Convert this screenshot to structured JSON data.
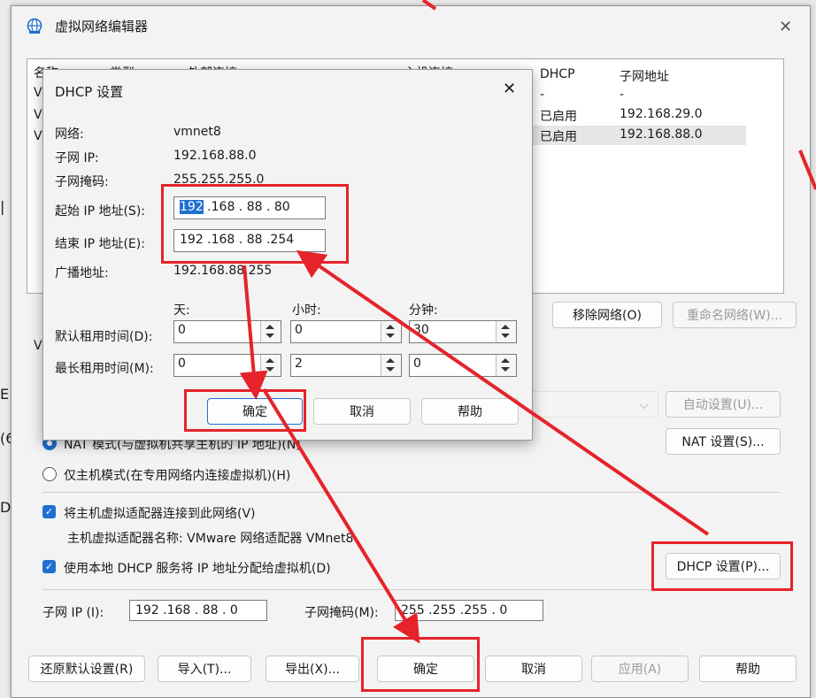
{
  "main": {
    "title": "虚拟网络编辑器",
    "close_label": "✕",
    "columns": [
      "名称",
      "类型",
      "外部连接",
      "主机连接",
      "DHCP",
      "子网地址"
    ],
    "left_clip": [
      "VI",
      "VI",
      "VI"
    ],
    "rows": [
      {
        "dhcp": "-",
        "subnet": "-"
      },
      {
        "dhcp": "已启用",
        "subnet": "192.168.29.0"
      },
      {
        "dhcp": "已启用",
        "subnet": "192.168.88.0"
      }
    ],
    "remove_network": "移除网络(O)",
    "rename_network": "重命名网络(W)...",
    "vm_clip": "V",
    "auto_settings": "自动设置(U)...",
    "nat_mode": "NAT 模式(与虚拟机共享主机的 IP 地址)(N)",
    "nat_settings": "NAT 设置(S)...",
    "host_only": "仅主机模式(在专用网络内连接虚拟机)(H)",
    "connect_adapter": "将主机虚拟适配器连接到此网络(V)",
    "adapter_name": "主机虚拟适配器名称: VMware 网络适配器 VMnet8",
    "use_dhcp": "使用本地 DHCP 服务将 IP 地址分配给虚拟机(D)",
    "dhcp_settings": "DHCP 设置(P)...",
    "subnet_ip_label": "子网 IP (I):",
    "subnet_ip": "192 .168 . 88 .  0",
    "subnet_mask_label": "子网掩码(M):",
    "subnet_mask": "255 .255 .255 .  0",
    "restore": "还原默认设置(R)",
    "import": "导入(T)...",
    "export": "导出(X)...",
    "ok": "确定",
    "cancel": "取消",
    "apply": "应用(A)",
    "help": "帮助"
  },
  "dhcp": {
    "title": "DHCP 设置",
    "close": "✕",
    "network_label": "网络:",
    "network": "vmnet8",
    "subnet_ip_label": "子网 IP:",
    "subnet_ip": "192.168.88.0",
    "subnet_mask_label": "子网掩码:",
    "subnet_mask": "255.255.255.0",
    "start_ip_label": "起始 IP 地址(S):",
    "start_ip_first": "192",
    "start_ip_rest": " .168 . 88  . 80",
    "end_ip_label": "结束 IP 地址(E):",
    "end_ip": "192 .168 . 88  .254",
    "broadcast_label": "广播地址:",
    "broadcast": "192.168.88.255",
    "days": "天:",
    "hours": "小时:",
    "minutes": "分钟:",
    "default_lease": "默认租用时间(D):",
    "default_values": [
      "0",
      "0",
      "30"
    ],
    "max_lease": "最长租用时间(M):",
    "max_values": [
      "0",
      "2",
      "0"
    ],
    "ok": "确定",
    "cancel": "取消",
    "help": "帮助"
  },
  "colors": {
    "highlight_red": "#e6232a",
    "accent_blue": "#1f6fd1"
  }
}
